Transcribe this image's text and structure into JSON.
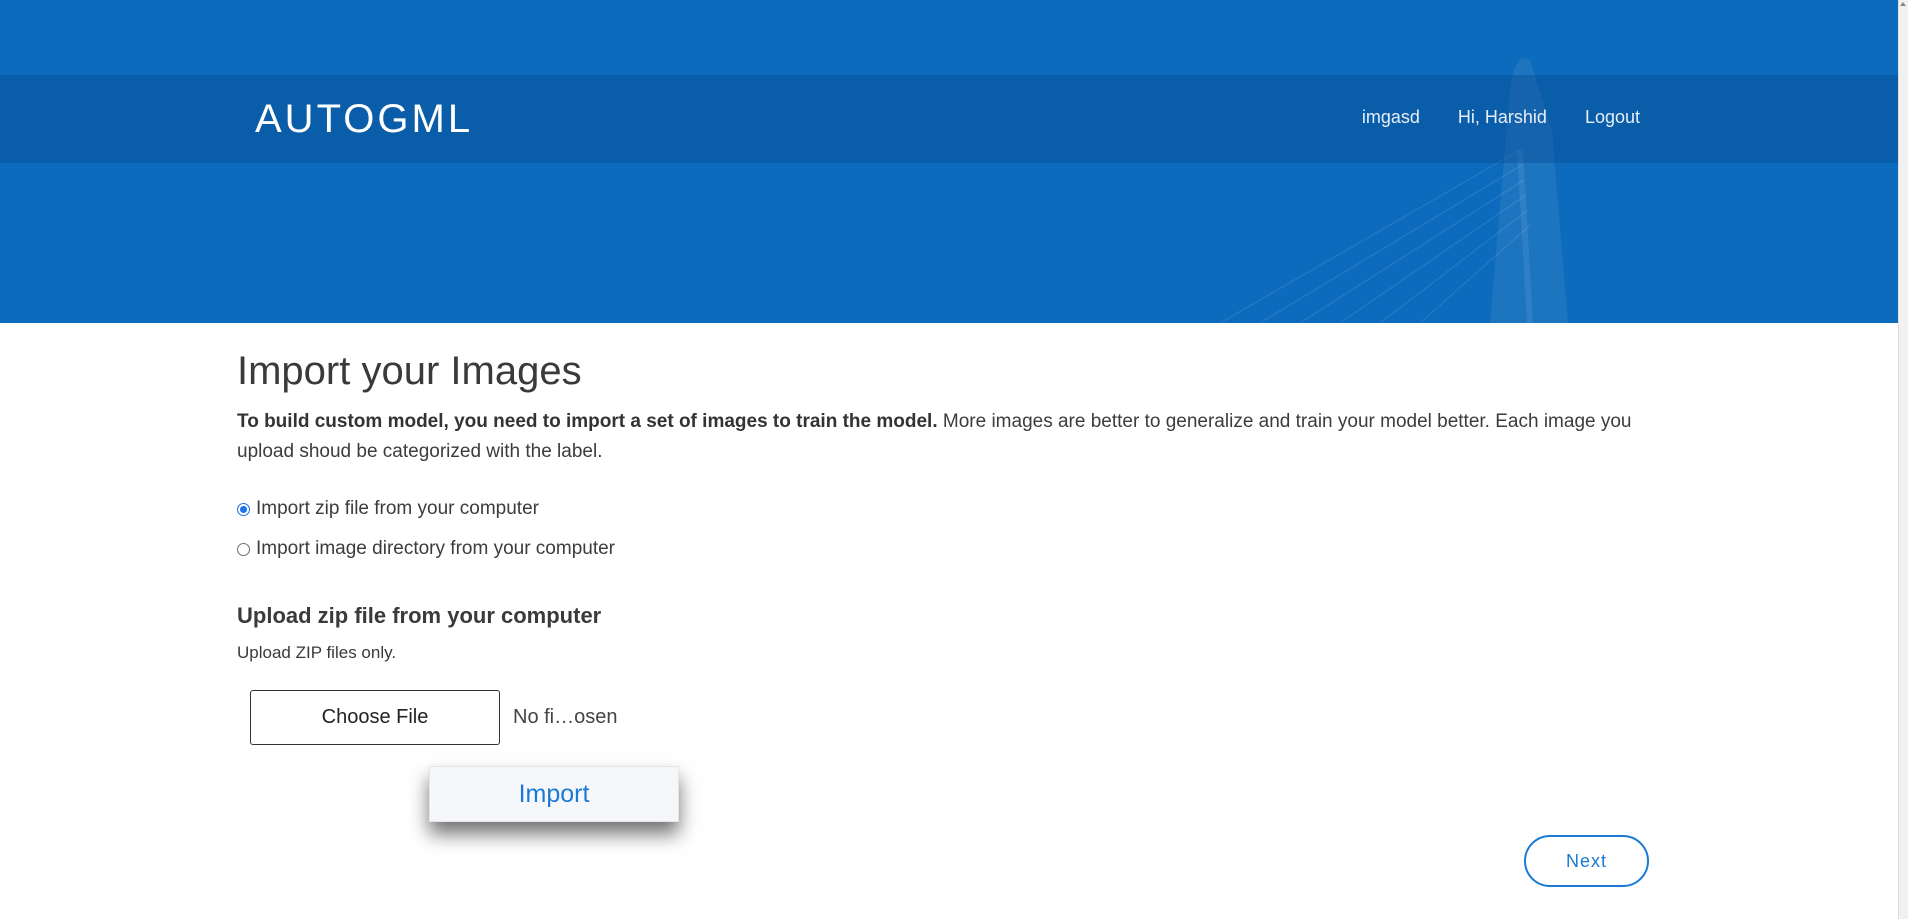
{
  "header": {
    "brand": "AUTOGML",
    "nav": [
      {
        "label": "imgasd"
      },
      {
        "label": "Hi, Harshid"
      },
      {
        "label": "Logout"
      }
    ],
    "background_color": "#0c6bbc"
  },
  "main": {
    "title": "Import your Images",
    "intro_bold": "To build custom model, you need to import a set of images to train the model.",
    "intro_rest": " More images are better to generalize and train your model better. Each image you upload shoud be categorized with the label.",
    "options": [
      {
        "label": "Import zip file from your computer",
        "checked": true
      },
      {
        "label": "Import image directory from your computer",
        "checked": false
      }
    ],
    "upload": {
      "title": "Upload zip file from your computer",
      "hint": "Upload ZIP files only.",
      "choose_label": "Choose File",
      "file_status": "No fi…osen"
    },
    "import_label": "Import",
    "next_label": "Next"
  },
  "colors": {
    "accent": "#1a7ad4",
    "radio_checked": "#1a73e8"
  }
}
